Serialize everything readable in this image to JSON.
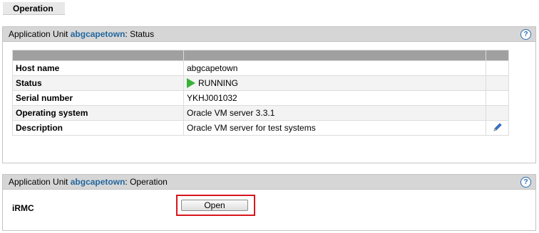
{
  "tab": {
    "label": "Operation"
  },
  "status_panel": {
    "title_prefix": "Application Unit",
    "unit_name": "abgcapetown",
    "title_suffix": ": Status",
    "help_glyph": "?",
    "rows": [
      {
        "label": "Host name",
        "value": "abgcapetown"
      },
      {
        "label": "Status",
        "value": "RUNNING",
        "icon": "play-status-icon"
      },
      {
        "label": "Serial number",
        "value": "YKHJ001032"
      },
      {
        "label": "Operating system",
        "value": "Oracle VM server 3.3.1"
      },
      {
        "label": "Description",
        "value": "Oracle VM server for test systems",
        "icon": "pencil-edit-icon"
      }
    ]
  },
  "operation_panel": {
    "title_prefix": "Application Unit",
    "unit_name": "abgcapetown",
    "title_suffix": ": Operation",
    "help_glyph": "?",
    "irmc_label": "iRMC",
    "open_button_label": "Open"
  },
  "colors": {
    "header_bg": "#d6d6d6",
    "link_blue": "#23679e",
    "running_green": "#39b239",
    "highlight_red": "#d8161d"
  }
}
